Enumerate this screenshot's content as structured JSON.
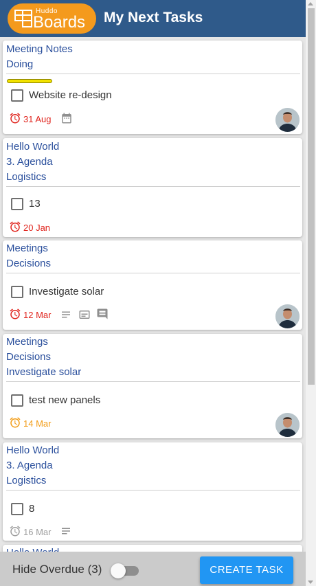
{
  "header": {
    "logo_small": "Huddo",
    "logo_big": "Boards",
    "title": "My Next Tasks"
  },
  "colors": {
    "header_bg": "#2f5a8a",
    "logo_bg": "#f49a1d",
    "link": "#2a4f9c",
    "overdue": "#e0231c",
    "due_soon": "#f29b14",
    "future": "#9e9e9e",
    "button": "#2196f3",
    "label_yellow": "#f2e200"
  },
  "cards": [
    {
      "crumbs": [
        "Meeting Notes",
        "Doing"
      ],
      "has_label": true,
      "task": "Website re-design",
      "date": "31 Aug",
      "date_status": "overdue",
      "icons": [
        "calendar-icon"
      ],
      "has_avatar": true
    },
    {
      "crumbs": [
        "Hello World",
        "3. Agenda",
        "Logistics"
      ],
      "has_label": false,
      "task": "13",
      "date": "20 Jan",
      "date_status": "overdue",
      "icons": [],
      "has_avatar": false
    },
    {
      "crumbs": [
        "Meetings",
        "Decisions"
      ],
      "has_label": false,
      "task": "Investigate solar",
      "date": "12 Mar",
      "date_status": "overdue",
      "icons": [
        "description-icon",
        "subtitles-icon",
        "comment-icon"
      ],
      "has_avatar": true
    },
    {
      "crumbs": [
        "Meetings",
        "Decisions",
        "Investigate solar"
      ],
      "has_label": false,
      "task": "test new panels",
      "date": "14 Mar",
      "date_status": "due_soon",
      "icons": [],
      "has_avatar": true
    },
    {
      "crumbs": [
        "Hello World",
        "3. Agenda",
        "Logistics"
      ],
      "has_label": false,
      "task": "8",
      "date": "16 Mar",
      "date_status": "future",
      "icons": [
        "description-icon"
      ],
      "has_avatar": false
    },
    {
      "crumbs": [
        "Hello World"
      ],
      "partial": true
    }
  ],
  "footer": {
    "hide_overdue_label": "Hide Overdue (3)",
    "toggle_on": false,
    "create_label": "CREATE TASK"
  }
}
